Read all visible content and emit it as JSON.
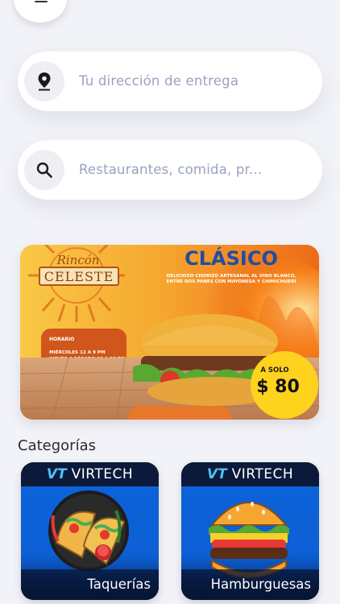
{
  "address": {
    "placeholder": "Tu dirección de entrega"
  },
  "search": {
    "placeholder": "Restaurantes, comida, pr..."
  },
  "promo": {
    "brand_top": "Rincón",
    "brand_name": "CELESTE",
    "title": "CLÁSICO",
    "description_line1": "DELICIOSO CHORIZO ARTESANAL AL VINO BLANCO,",
    "description_line2": "ENTRE DOS PANES CON MAYONESA Y CHIMICHURRI",
    "schedule_title": "HORARIO",
    "schedule_line1": "MIÉRCOLES 12 A 9 PM",
    "schedule_line2": "JUEVES A SÁBADO 12 A 10 PM",
    "price_prefix": "A SOLO",
    "price": "$ 80"
  },
  "categories": {
    "title": "Categorías",
    "items": [
      {
        "label": "Taquerías",
        "brand_mark": "VT",
        "brand_name": "VIRTECH"
      },
      {
        "label": "Hamburguesas",
        "brand_mark": "VT",
        "brand_name": "VIRTECH"
      }
    ]
  }
}
